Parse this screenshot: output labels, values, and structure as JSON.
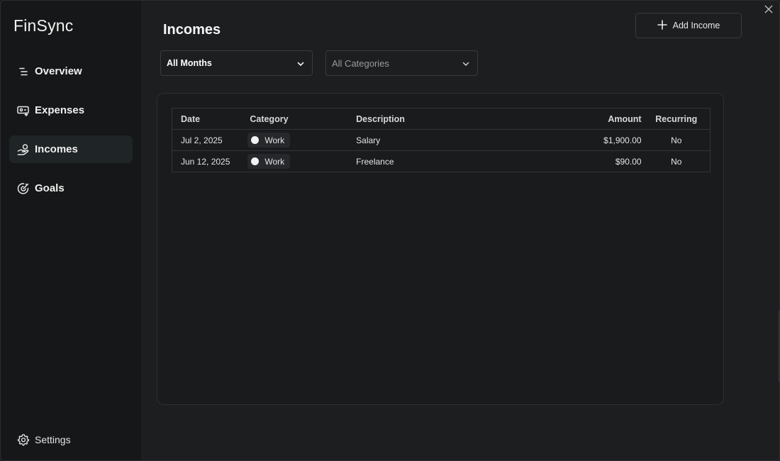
{
  "app": {
    "brand": "FinSync"
  },
  "sidebar": {
    "items": [
      {
        "label": "Overview",
        "icon": "list-icon"
      },
      {
        "label": "Expenses",
        "icon": "wallet-icon"
      },
      {
        "label": "Incomes",
        "icon": "hand-coin-icon",
        "active": true
      },
      {
        "label": "Goals",
        "icon": "target-icon"
      }
    ],
    "settings": {
      "label": "Settings",
      "icon": "gear-icon"
    }
  },
  "header": {
    "title": "Incomes",
    "add_button": "Add Income"
  },
  "filters": {
    "month": "All Months",
    "category": "All Categories"
  },
  "table": {
    "columns": [
      "Date",
      "Category",
      "Description",
      "Amount",
      "Recurring"
    ],
    "rows": [
      {
        "date": "Jul 2, 2025",
        "category": "Work",
        "description": "Salary",
        "amount": "$1,900.00",
        "recurring": "No"
      },
      {
        "date": "Jun 12, 2025",
        "category": "Work",
        "description": "Freelance",
        "amount": "$90.00",
        "recurring": "No"
      }
    ]
  },
  "colors": {
    "background": "#1d1e20",
    "sidebar": "#161718",
    "active_nav": "#1f2426",
    "border": "#34353a",
    "category_dot": "#f2f2f2"
  }
}
